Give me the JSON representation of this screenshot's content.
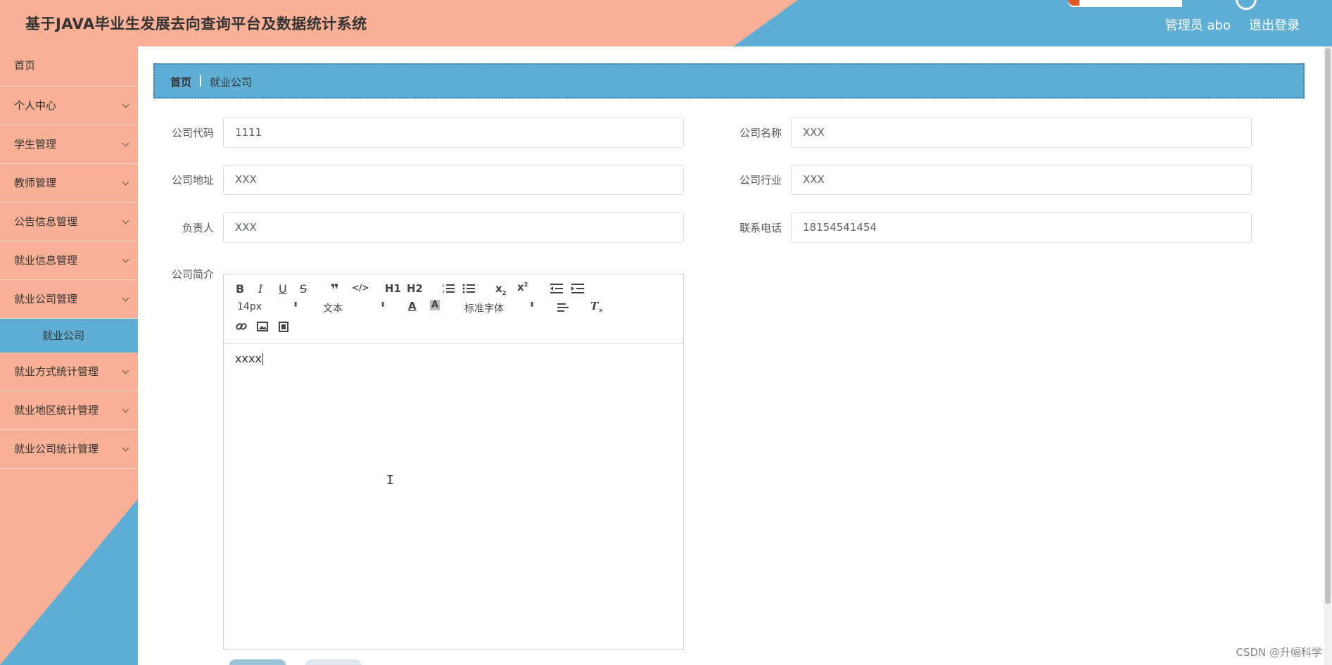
{
  "header": {
    "title": "基于JAVA毕业生发展去向查询平台及数据统计系统",
    "user": "管理员 abo",
    "logout": "退出登录"
  },
  "sidebar": {
    "items": [
      {
        "label": "首页"
      },
      {
        "label": "个人中心"
      },
      {
        "label": "学生管理"
      },
      {
        "label": "教师管理"
      },
      {
        "label": "公告信息管理"
      },
      {
        "label": "就业信息管理"
      },
      {
        "label": "就业公司管理"
      },
      {
        "label": "就业方式统计管理"
      },
      {
        "label": "就业地区统计管理"
      },
      {
        "label": "就业公司统计管理"
      }
    ],
    "active_sub": "就业公司"
  },
  "breadcrumb": {
    "home": "首页",
    "current": "就业公司"
  },
  "form": {
    "company_code": {
      "label": "公司代码",
      "value": "1111"
    },
    "company_name": {
      "label": "公司名称",
      "value": "XXX"
    },
    "company_address": {
      "label": "公司地址",
      "value": "XXX"
    },
    "company_industry": {
      "label": "公司行业",
      "value": "XXX"
    },
    "person_in_charge": {
      "label": "负责人",
      "value": "XXX"
    },
    "contact_phone": {
      "label": "联系电话",
      "value": "18154541454"
    },
    "intro": {
      "label": "公司简介",
      "content": "xxxx"
    }
  },
  "editor": {
    "font_size": "14px",
    "header_select": "文本",
    "font_family": "标准字体",
    "h1": "H1",
    "h2": "H2"
  },
  "watermark": "CSDN @升幅科学",
  "colors": {
    "salmon": "#f8b096",
    "blue": "#5eaed5"
  }
}
